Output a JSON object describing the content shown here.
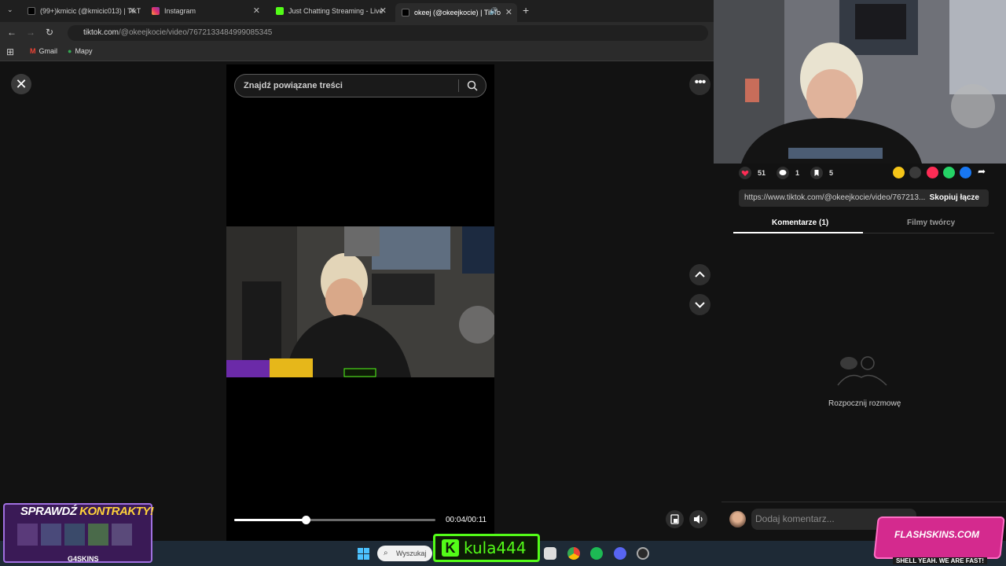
{
  "browser": {
    "tabs": [
      {
        "title": "(99+)kmicic (@kmicic013) | TikT",
        "favicon": "tiktok-icon",
        "color": "#ffffff"
      },
      {
        "title": "Instagram",
        "favicon": "instagram-icon",
        "color": "#e1306c"
      },
      {
        "title": "Just Chatting Streaming - Live",
        "favicon": "kick-icon",
        "color": "#53fc18"
      },
      {
        "title": "okeej (@okeejkocie) | TikTo",
        "favicon": "tiktok-icon",
        "color": "#ffffff"
      }
    ],
    "url_host": "tiktok.com",
    "url_path": "/@okeejkocie/video/7672133484999085345",
    "bookmarks": [
      "Gmail",
      "Mapy"
    ]
  },
  "player": {
    "search_placeholder": "Znajdź powiązane treści",
    "time": "00:04/00:11",
    "progress": 0.36
  },
  "stats": {
    "likes": "51",
    "comments": "1",
    "saves": "5"
  },
  "share_colors": [
    "#f5c518",
    "#3a3a3a",
    "#fe2c55",
    "#25d366",
    "#1877f2"
  ],
  "link": {
    "url": "https://www.tiktok.com/@okeejkocie/video/767213...",
    "copy_label": "Skopiuj łącze"
  },
  "panel_tabs": [
    "Komentarze (1)",
    "Filmy twórcy"
  ],
  "empty_state": "Rozpocznij rozmowę",
  "comment_placeholder": "Dodaj komentarz...",
  "taskbar": {
    "search": "Wyszukaj"
  },
  "overlays": {
    "kick_name": "kula444",
    "promo_title_white": "SPRAWDŹ ",
    "promo_title_yellow": "KONTRAKTY!",
    "promo_brand": "G4SKINS",
    "flash_name": "FLASHSKINS.COM",
    "flash_tag": "SHELL YEAH. WE ARE FAST!"
  }
}
